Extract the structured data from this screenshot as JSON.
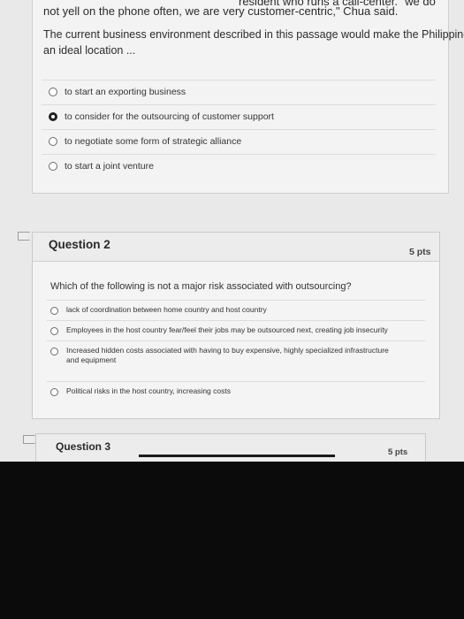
{
  "passage": {
    "line1": "resident who runs a call-center. \"we do",
    "line2": "not yell on the phone often, we are very customer-centric,\" Chua said."
  },
  "question1": {
    "stem_line1": "The current business environment described in this passage would make the Philippines",
    "stem_line2": "an ideal location ...",
    "options": [
      {
        "label": "to start an exporting business",
        "selected": false
      },
      {
        "label": "to consider for the outsourcing of customer support",
        "selected": true
      },
      {
        "label": "to negotiate some form of strategic alliance",
        "selected": false
      },
      {
        "label": "to start a joint venture",
        "selected": false
      }
    ]
  },
  "question2": {
    "title": "Question 2",
    "points": "5 pts",
    "stem": "Which of the following is not a major risk associated with outsourcing?",
    "options": [
      {
        "label": "lack of coordination between home country and host country"
      },
      {
        "label": "Employees in the host country fear/feel their jobs may be outsourced next, creating job insecurity"
      },
      {
        "label_line1": "Increased hidden costs associated with having to buy expensive, highly specialized infrastructure",
        "label_line2": "and equipment"
      },
      {
        "label": "Political risks in the host country, increasing costs"
      }
    ]
  },
  "question3": {
    "title": "Question 3",
    "points": "5 pts"
  },
  "colors": {
    "page_bg": "#e9e9e9",
    "card_bg": "#f4f4f4",
    "outside": "#0b0b0b"
  }
}
